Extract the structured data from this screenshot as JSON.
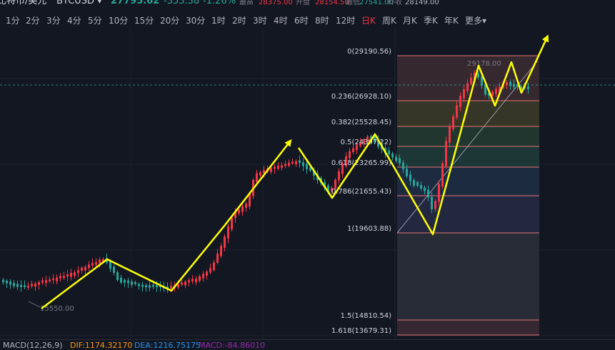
{
  "header": {
    "name": "比特币/美元",
    "symbol": "BTCUSD ▾",
    "price": "27795.62",
    "change": "-353.38",
    "change_pct": "-1.26%",
    "high_label": "最高",
    "high": "28375.00",
    "open_label": "开盘",
    "open": "28154.50",
    "low_label": "最低",
    "low": "27541.00",
    "prev_label": "昨收",
    "prev": "28149.00"
  },
  "timeframes": [
    "1分",
    "2分",
    "3分",
    "4分",
    "5分",
    "10分",
    "15分",
    "20分",
    "30分",
    "1时",
    "2时",
    "3时",
    "4时",
    "6时",
    "8时",
    "12时",
    "日K",
    "周K",
    "月K",
    "季K",
    "年K",
    "更多▾"
  ],
  "active_timeframe": "日K",
  "fib_levels": [
    {
      "ratio": "0",
      "label": "0(29190.56)",
      "color": "#e57373"
    },
    {
      "ratio": "0.236",
      "label": "0.236(26928.10)",
      "color": "#e57373"
    },
    {
      "ratio": "0.382",
      "label": "0.382(25528.45)",
      "color": "#e57373"
    },
    {
      "ratio": "0.5",
      "label": "0.5(24397.22)",
      "color": "#e57373"
    },
    {
      "ratio": "0.618",
      "label": "0.618(23265.99)",
      "color": "#e57373"
    },
    {
      "ratio": "0.786",
      "label": "0.786(21655.43)",
      "color": "#e57373"
    },
    {
      "ratio": "1",
      "label": "1(19603.88)",
      "color": "#e57373"
    },
    {
      "ratio": "1.5",
      "label": "1.5(14810.54)",
      "color": "#e57373"
    },
    {
      "ratio": "1.618",
      "label": "1.618(13679.31)",
      "color": "#e57373"
    }
  ],
  "annotations": {
    "high_marker": "29178.00",
    "low_marker": "15550.00"
  },
  "macd": {
    "label": "MACD(12,26,9)",
    "dif": "DIF:1174.32170",
    "dea": "DEA:1216.75175",
    "macd": "MACD:-84.86010"
  },
  "colors": {
    "up": "#f23645",
    "down": "#26a69a",
    "arrow": "#ffff00",
    "fib_line": "#e57373"
  }
}
